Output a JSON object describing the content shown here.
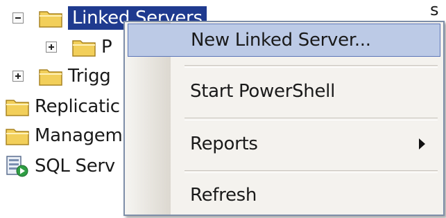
{
  "tree": {
    "items": [
      {
        "label": "Linked Servers",
        "expander": "minus",
        "icon": "folder-icon",
        "selected": true
      },
      {
        "label": "P",
        "expander": "plus",
        "icon": "folder-icon"
      },
      {
        "label": "Trigg",
        "expander": "plus",
        "icon": "folder-icon"
      },
      {
        "label": "Replicatic",
        "icon": "folder-icon"
      },
      {
        "label": "Managem",
        "icon": "folder-icon"
      },
      {
        "label": "SQL Serv",
        "icon": "sql-server-agent-icon"
      }
    ],
    "edge_char": "s"
  },
  "context_menu": {
    "items": [
      {
        "label": "New Linked Server...",
        "highlighted": true
      },
      {
        "label": "Start PowerShell"
      },
      {
        "label": "Reports",
        "submenu": true
      },
      {
        "label": "Refresh"
      }
    ]
  },
  "colors": {
    "selection": "#1f3a8f",
    "menu_highlight": "#bccae6",
    "folder": "#f2cf5a"
  }
}
